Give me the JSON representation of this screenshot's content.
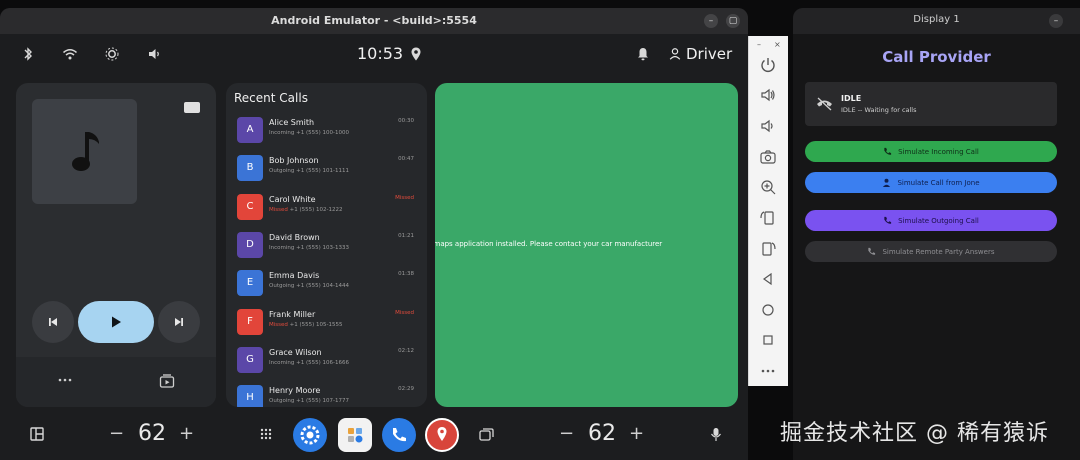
{
  "emulator": {
    "title": "Android Emulator - <build>:5554",
    "minimize_label": "–",
    "maximize_label": "▢"
  },
  "status_bar": {
    "time": "10:53",
    "user": "Driver"
  },
  "media": {
    "art_icon": "music-note-icon"
  },
  "recent_calls": {
    "title": "Recent Calls",
    "items": [
      {
        "initial": "A",
        "name": "Alice Smith",
        "type": "Incoming",
        "number": "+1 (555) 100-1000",
        "time": "00:30",
        "color": "#5b47a8",
        "missed": false
      },
      {
        "initial": "B",
        "name": "Bob Johnson",
        "type": "Outgoing",
        "number": "+1 (555) 101-1111",
        "time": "00:47",
        "color": "#3b74d6",
        "missed": false
      },
      {
        "initial": "C",
        "name": "Carol White",
        "type": "Missed",
        "number": "+1 (555) 102-1222",
        "time": "Missed",
        "color": "#e2453a",
        "missed": true
      },
      {
        "initial": "D",
        "name": "David Brown",
        "type": "Incoming",
        "number": "+1 (555) 103-1333",
        "time": "01:21",
        "color": "#5b47a8",
        "missed": false
      },
      {
        "initial": "E",
        "name": "Emma Davis",
        "type": "Outgoing",
        "number": "+1 (555) 104-1444",
        "time": "01:38",
        "color": "#3b74d6",
        "missed": false
      },
      {
        "initial": "F",
        "name": "Frank Miller",
        "type": "Missed",
        "number": "+1 (555) 105-1555",
        "time": "Missed",
        "color": "#e2453a",
        "missed": true
      },
      {
        "initial": "G",
        "name": "Grace Wilson",
        "type": "Incoming",
        "number": "+1 (555) 106-1666",
        "time": "02:12",
        "color": "#5b47a8",
        "missed": false
      },
      {
        "initial": "H",
        "name": "Henry Moore",
        "type": "Outgoing",
        "number": "+1 (555) 107-1777",
        "time": "02:29",
        "color": "#3b74d6",
        "missed": false
      }
    ]
  },
  "map": {
    "message": "o maps application installed. Please contact your car manufacturer",
    "background": "#3aa868"
  },
  "bottom_bar": {
    "left_temp": "62",
    "right_temp": "62",
    "minus": "−",
    "plus": "+"
  },
  "display1": {
    "title": "Display 1",
    "provider_title": "Call Provider",
    "state": "IDLE",
    "state_detail": "IDLE -- Waiting for calls",
    "buttons": [
      {
        "label": "Simulate Incoming Call",
        "color": "#2fa84f",
        "text_color": "#0f2e18"
      },
      {
        "label": "Simulate Call from Jone",
        "color": "#3b7ff0",
        "text_color": "#0f2050"
      },
      {
        "label": "Simulate Outgoing Call",
        "color": "#7a52f0",
        "text_color": "#1d104a"
      },
      {
        "label": "Simulate Remote Party Answers",
        "color": "#303033",
        "text_color": "#8e8e92"
      }
    ]
  },
  "watermark": "掘金技术社区 @ 稀有猿诉"
}
